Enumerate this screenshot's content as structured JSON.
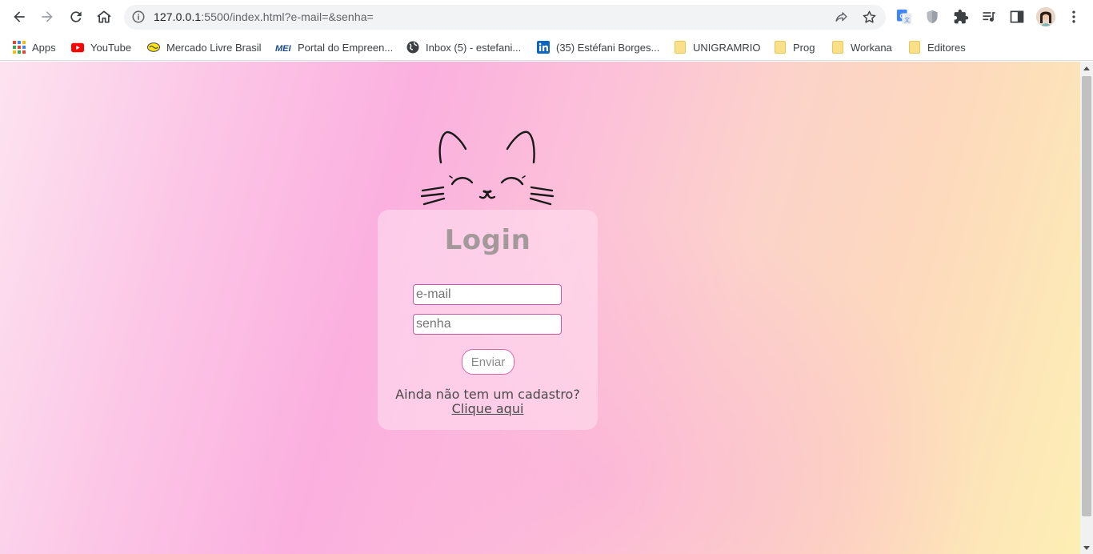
{
  "browser": {
    "url_host": "127.0.0.1",
    "url_rest": ":5500/index.html?e-mail=&senha="
  },
  "bookmarks": [
    {
      "label": "Apps",
      "icon": "apps-grid-icon"
    },
    {
      "label": "YouTube",
      "icon": "youtube-icon"
    },
    {
      "label": "Mercado Livre Brasil",
      "icon": "mercado-livre-icon"
    },
    {
      "label": "Portal do Empreen...",
      "icon": "mei-icon"
    },
    {
      "label": "Inbox (5) - estefani...",
      "icon": "globe-icon"
    },
    {
      "label": "(35) Estéfani Borges...",
      "icon": "linkedin-icon"
    },
    {
      "label": "UNIGRAMRIO",
      "icon": "folder-icon"
    },
    {
      "label": "Prog",
      "icon": "folder-icon"
    },
    {
      "label": "Workana",
      "icon": "folder-icon"
    },
    {
      "label": "Editores",
      "icon": "folder-icon"
    }
  ],
  "colors": {
    "card_title": "#a3999b",
    "field_border": "#c659a2",
    "button_border": "#d46aa8"
  },
  "login": {
    "title": "Login",
    "email_placeholder": "e-mail",
    "password_placeholder": "senha",
    "submit_label": "Enviar",
    "signup_prompt": "Ainda não tem um cadastro?",
    "signup_link": "Clique aqui"
  }
}
